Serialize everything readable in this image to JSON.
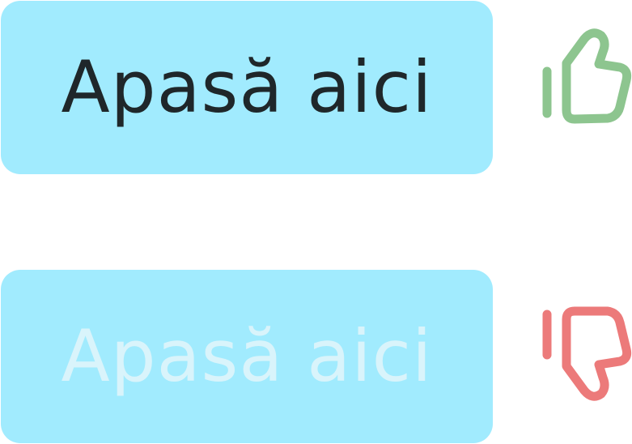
{
  "examples": [
    {
      "button_label": "Apasă aici",
      "verdict_icon": "thumbs-up-icon",
      "verdict_color": "#8dc58f",
      "button_color": "#a1ebfe",
      "text_color": "#1f272a"
    },
    {
      "button_label": "Apasă aici",
      "verdict_icon": "thumbs-down-icon",
      "verdict_color": "#ec7a7a",
      "button_color": "#a1ebfe",
      "text_color": "#d9f4fb"
    }
  ]
}
